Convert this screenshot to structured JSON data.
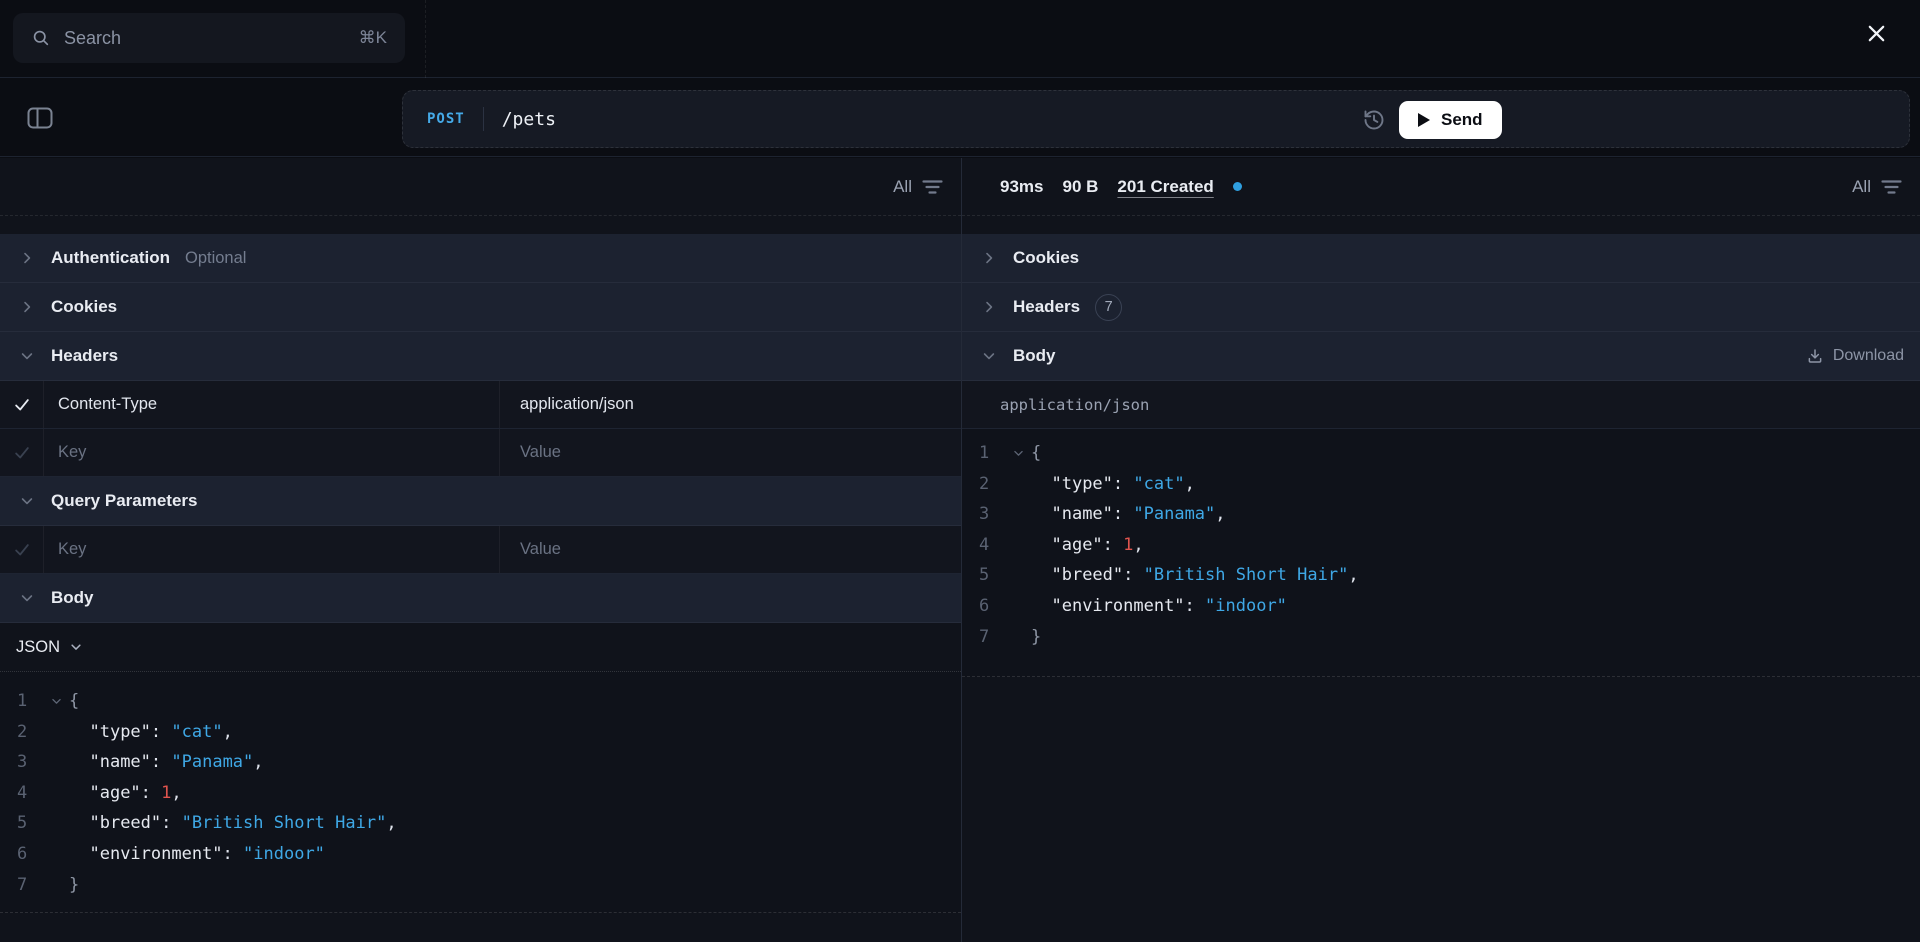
{
  "topbar": {
    "search_placeholder": "Search",
    "search_shortcut": "⌘K"
  },
  "request": {
    "method": "POST",
    "url": "/pets",
    "send_label": "Send"
  },
  "left": {
    "filter_label": "All",
    "authentication": {
      "label": "Authentication",
      "suffix": "Optional"
    },
    "cookies": {
      "label": "Cookies"
    },
    "headers": {
      "label": "Headers"
    },
    "header_row": {
      "key": "Content-Type",
      "value": "application/json"
    },
    "placeholder_row": {
      "key": "Key",
      "value": "Value"
    },
    "query_parameters": {
      "label": "Query Parameters"
    },
    "body": {
      "label": "Body"
    },
    "body_type": "JSON"
  },
  "right": {
    "filter_label": "All",
    "meta": {
      "duration": "93ms",
      "size": "90 B",
      "status": "201 Created"
    },
    "cookies": {
      "label": "Cookies"
    },
    "headers": {
      "label": "Headers",
      "badge": "7"
    },
    "body": {
      "label": "Body",
      "download_label": "Download"
    },
    "mime": "application/json"
  },
  "colors": {
    "accent_blue": "#3fa8e6",
    "number_red": "#e0544e",
    "status_dot": "#2f9fe0",
    "send_button_bg": "#ffffff",
    "section_row_bg": "#1c2230",
    "page_bg": "#0b0d13"
  },
  "code": {
    "lines": [
      {
        "n": "1",
        "fold": true,
        "tokens": [
          {
            "c": "brace",
            "t": "{"
          }
        ]
      },
      {
        "n": "2",
        "tokens": [
          {
            "c": "ws",
            "t": "  "
          },
          {
            "c": "key",
            "t": "\"type\""
          },
          {
            "c": "pun",
            "t": ": "
          },
          {
            "c": "str",
            "t": "\"cat\""
          },
          {
            "c": "pun",
            "t": ","
          }
        ]
      },
      {
        "n": "3",
        "tokens": [
          {
            "c": "ws",
            "t": "  "
          },
          {
            "c": "key",
            "t": "\"name\""
          },
          {
            "c": "pun",
            "t": ": "
          },
          {
            "c": "str",
            "t": "\"Panama\""
          },
          {
            "c": "pun",
            "t": ","
          }
        ]
      },
      {
        "n": "4",
        "tokens": [
          {
            "c": "ws",
            "t": "  "
          },
          {
            "c": "key",
            "t": "\"age\""
          },
          {
            "c": "pun",
            "t": ": "
          },
          {
            "c": "num",
            "t": "1"
          },
          {
            "c": "pun",
            "t": ","
          }
        ]
      },
      {
        "n": "5",
        "tokens": [
          {
            "c": "ws",
            "t": "  "
          },
          {
            "c": "key",
            "t": "\"breed\""
          },
          {
            "c": "pun",
            "t": ": "
          },
          {
            "c": "str",
            "t": "\"British Short Hair\""
          },
          {
            "c": "pun",
            "t": ","
          }
        ]
      },
      {
        "n": "6",
        "tokens": [
          {
            "c": "ws",
            "t": "  "
          },
          {
            "c": "key",
            "t": "\"environment\""
          },
          {
            "c": "pun",
            "t": ": "
          },
          {
            "c": "str",
            "t": "\"indoor\""
          }
        ]
      },
      {
        "n": "7",
        "tokens": [
          {
            "c": "brace",
            "t": "}"
          }
        ]
      }
    ]
  }
}
